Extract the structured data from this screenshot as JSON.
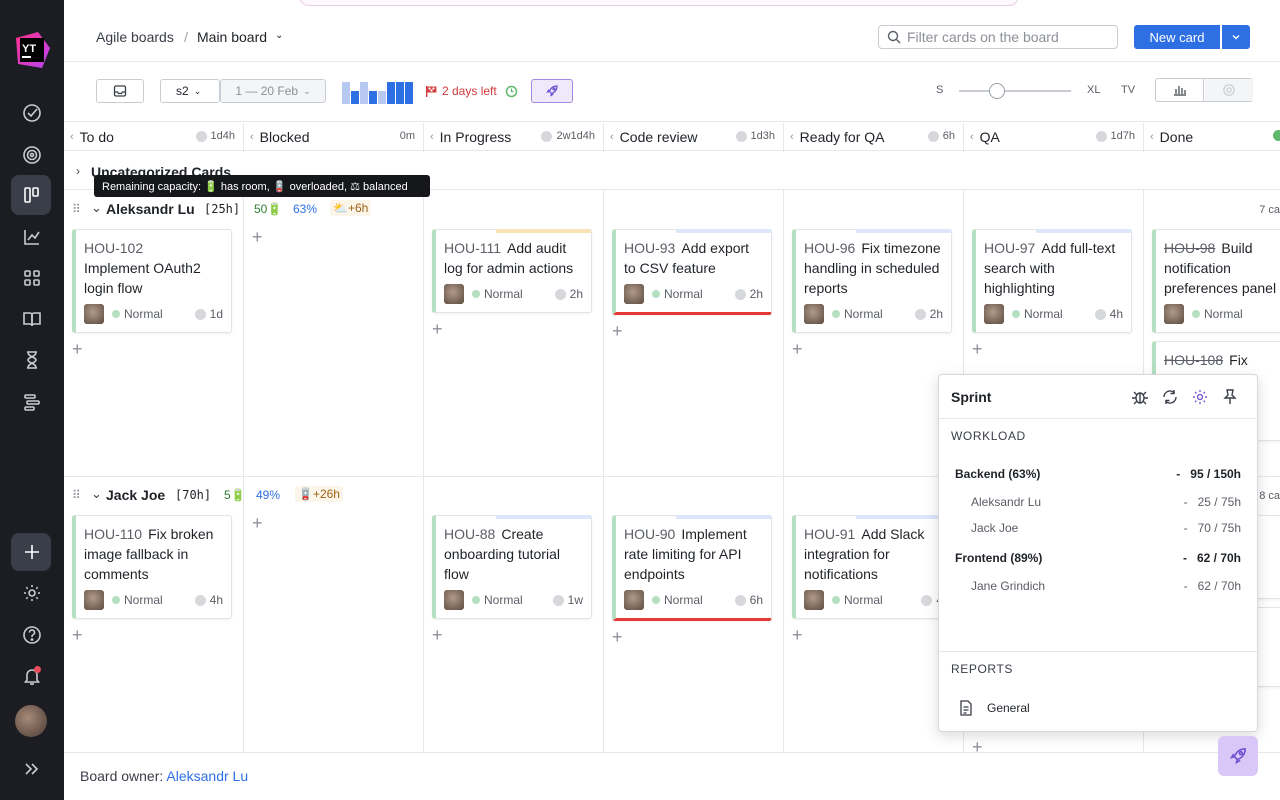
{
  "breadcrumb": {
    "parent": "Agile boards",
    "separator": "/",
    "current": "Main board"
  },
  "header": {
    "search_placeholder": "Filter cards on the board",
    "new_card": "New card"
  },
  "toolbar": {
    "sprint": "s2",
    "dates": "1 — 20 Feb",
    "days_left": "2 days left",
    "size_s": "S",
    "size_xl": "XL",
    "size_tv": "TV"
  },
  "burndown_levels": [
    0.9,
    0.55,
    0.9,
    0.55,
    0.55,
    0.9,
    0.9,
    0.9
  ],
  "columns": [
    {
      "name": "To do",
      "time": "1d4h"
    },
    {
      "name": "Blocked",
      "time": "0m"
    },
    {
      "name": "In Progress",
      "time": "2w1d4h"
    },
    {
      "name": "Code review",
      "time": "1d3h"
    },
    {
      "name": "Ready for QA",
      "time": "6h"
    },
    {
      "name": "QA",
      "time": "1d7h"
    },
    {
      "name": "Done",
      "time": ""
    }
  ],
  "uncategorized": "Uncategorized Cards",
  "tooltip": "Remaining capacity: 🔋 has room, 🪫 overloaded, ⚖ balanced",
  "swimlanes": [
    {
      "name": "Aleksandr Lu",
      "hours": "[25h]",
      "cards": "50🔋",
      "percent": "63%",
      "extra": "⛅+6h",
      "count": "7 ca"
    },
    {
      "name": "Jack Joe",
      "hours": "[70h]",
      "cards": "5🔋",
      "percent": "49%",
      "extra": "🪫+26h",
      "count": "8 ca"
    }
  ],
  "cards": [
    {
      "key": "HOU-102",
      "summary": "Implement OAuth2 login flow",
      "priority": "Normal",
      "estimate": "1d"
    },
    {
      "key": "HOU-111",
      "summary": "Add audit log for admin actions",
      "priority": "Normal",
      "estimate": "2h"
    },
    {
      "key": "HOU-93",
      "summary": "Add export to CSV feature",
      "priority": "Normal",
      "estimate": "2h"
    },
    {
      "key": "HOU-96",
      "summary": "Fix timezone handling in scheduled reports",
      "priority": "Normal",
      "estimate": "2h"
    },
    {
      "key": "HOU-97",
      "summary": "Add full-text search with highlighting",
      "priority": "Normal",
      "estimate": "4h"
    },
    {
      "key": "HOU-98",
      "summary": "Build notification preferences panel",
      "priority": "Normal",
      "estimate": ""
    },
    {
      "key": "HOU-108",
      "summary": "Fix",
      "priority": "",
      "estimate": ""
    },
    {
      "key": "HOU-110",
      "summary": "Fix broken image fallback in comments",
      "priority": "Normal",
      "estimate": "4h"
    },
    {
      "key": "HOU-88",
      "summary": "Create onboarding tutorial flow",
      "priority": "Normal",
      "estimate": "1w"
    },
    {
      "key": "HOU-90",
      "summary": "Implement rate limiting for API endpoints",
      "priority": "Normal",
      "estimate": "6h"
    },
    {
      "key": "HOU-91",
      "summary": "Add Slack integration for notifications",
      "priority": "Normal",
      "estimate": "4"
    }
  ],
  "sprint_panel": {
    "title": "Sprint",
    "workload_label": "WORKLOAD",
    "groups": [
      {
        "name": "Backend (63%)",
        "value": "95 / 150h"
      },
      {
        "name": "Aleksandr Lu",
        "value": "25 / 75h"
      },
      {
        "name": "Jack Joe",
        "value": "70 / 75h"
      },
      {
        "name": "Frontend (89%)",
        "value": "62 / 70h"
      },
      {
        "name": "Jane Grindich",
        "value": "62 / 70h"
      }
    ],
    "dash": "-",
    "reports_label": "REPORTS",
    "report": "General"
  },
  "footer": {
    "label": "Board owner:",
    "owner": "Aleksandr Lu"
  },
  "colors": {
    "accent": "#2f6fe4",
    "sidebar": "#1b1d22",
    "priority_normal": "#b4dfc1",
    "overdue": "#d03a3a"
  }
}
